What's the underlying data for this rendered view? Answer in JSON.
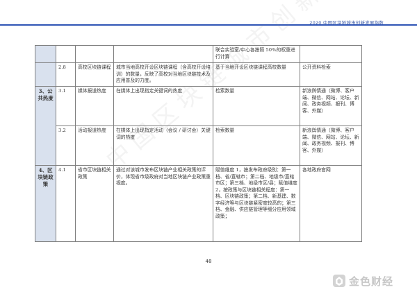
{
  "header": {
    "title": "2020 中国区块链城市创新发展指数"
  },
  "table": {
    "continuation_note": "联合实验室/中心各按照 50%的权重进行计算",
    "rows": [
      {
        "num": "2.8",
        "name": "高校区块链课程",
        "definition": "城市当地高校开设区块链课程（含高校开设培训）的数量，反映了高校对当地区块链技术及应用普及的力度。",
        "measure": "基于当地开设区块链课程高校数量",
        "source": "公开资料检索"
      },
      {
        "category": "3、公共热度",
        "num": "3.1",
        "name": "媒体报道热度",
        "definition": "在媒体上出现指定关键词的热度",
        "measure": "检索数量",
        "source": "新浪舆情通（微博、客户端、微信、网站、论坛、新闻、政务视频、报刊、博客、外媒）"
      },
      {
        "num": "3.2",
        "name": "活动报道热度",
        "definition": "在媒体上出现指定活动（会议 / 研讨会）关键词的热度",
        "measure": "检索数量",
        "source": "新浪舆情通（微博、客户端、微信、网站、论坛、新闻、政务视频、报刊、博客、外媒）"
      },
      {
        "category": "4、区块链政策",
        "num": "4.1",
        "name": "省市区块链相关政策",
        "definition": "通过对该城市发布区块链产业相关政策的评价，体现省市级政府对当地区块链产业政策重视度。",
        "measure": "赋值维度 1，按发布政府级别：第一档、省/直辖市；第二档、地级市/直辖市区；第三档、地级市区/县；赋值维度 2，按政策与区块链相关程度：第一档、区块链政策；第二档、新基建、数字经济等与区块链紧密度较高的；第三档、金融、供应链管理等细分应用领域政策；",
        "source": "各地政府官网"
      }
    ]
  },
  "page_number": "48",
  "watermark": "中国区块链城市创新发展指",
  "brand": {
    "name": "金色财经"
  }
}
